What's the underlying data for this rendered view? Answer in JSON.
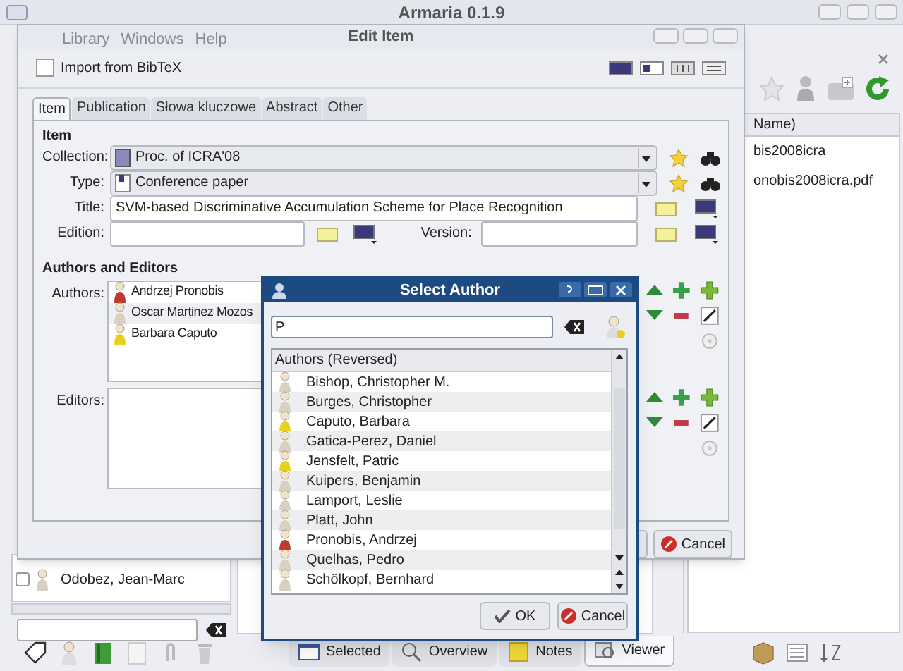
{
  "main_window": {
    "title": "Armaria 0.1.9",
    "menu": [
      "Library",
      "Windows",
      "Help"
    ],
    "file_list": {
      "header": "Name)",
      "items": [
        "bis2008icra",
        "onobis2008icra.pdf"
      ]
    },
    "author_list": {
      "rows": [
        {
          "name": "Odobez, Jean-Marc",
          "checked": false,
          "color": "#d8d0c0"
        }
      ]
    },
    "view_tabs": [
      {
        "label": "Selected",
        "selected": false
      },
      {
        "label": "Overview",
        "selected": false
      },
      {
        "label": "Notes",
        "selected": false
      },
      {
        "label": "Viewer",
        "selected": true
      }
    ]
  },
  "edit_item": {
    "title": "Edit Item",
    "import_button": "Import from BibTeX",
    "tabs": [
      {
        "label": "Item",
        "selected": true
      },
      {
        "label": "Publication",
        "selected": false
      },
      {
        "label": "Słowa kluczowe",
        "selected": false
      },
      {
        "label": "Abstract",
        "selected": false
      },
      {
        "label": "Other",
        "selected": false
      }
    ],
    "section": "Item",
    "collection_label": "Collection:",
    "collection": "Proc. of ICRA'08",
    "type_label": "Type:",
    "type": "Conference paper",
    "title_label": "Title:",
    "title_value": "SVM-based Discriminative Accumulation Scheme for Place Recognition",
    "edition_label": "Edition:",
    "version_label": "Version:",
    "authors_section": "Authors and Editors",
    "authors_label": "Authors:",
    "authors": [
      {
        "name": "Andrzej Pronobis",
        "color": "#c0392b"
      },
      {
        "name": "Oscar Martinez Mozos",
        "color": "#d8d0c0"
      },
      {
        "name": "Barbara Caputo",
        "color": "#e6d21e"
      }
    ],
    "editors_label": "Editors:",
    "cancel_button": "Cancel"
  },
  "select_author": {
    "title": "Select Author",
    "search": "P",
    "column": "Authors (Reversed)",
    "authors": [
      {
        "name": "Bishop, Christopher M.",
        "color": "#d8d0c0"
      },
      {
        "name": "Burges, Christopher",
        "color": "#d8d0c0"
      },
      {
        "name": "Caputo, Barbara",
        "color": "#e6d21e"
      },
      {
        "name": "Gatica-Perez, Daniel",
        "color": "#d8d0c0"
      },
      {
        "name": "Jensfelt, Patric",
        "color": "#e6d21e"
      },
      {
        "name": "Kuipers, Benjamin",
        "color": "#d8d0c0"
      },
      {
        "name": "Lamport, Leslie",
        "color": "#d8d0c0"
      },
      {
        "name": "Platt, John",
        "color": "#d8d0c0"
      },
      {
        "name": "Pronobis, Andrzej",
        "color": "#c0392b"
      },
      {
        "name": "Quelhas, Pedro",
        "color": "#d8d0c0"
      },
      {
        "name": "Schölkopf, Bernhard",
        "color": "#d8d0c0"
      }
    ],
    "ok_button": "OK",
    "cancel_button": "Cancel"
  }
}
